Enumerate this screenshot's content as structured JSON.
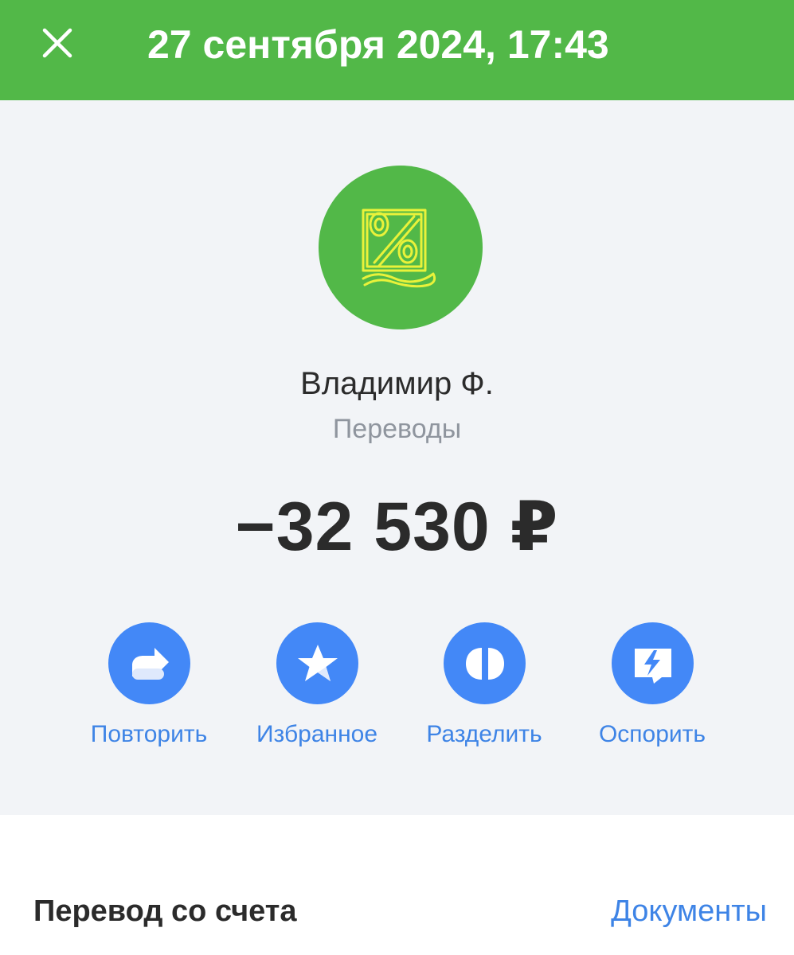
{
  "header": {
    "title": "27 сентября 2024, 17:43",
    "background_color": "#52b848",
    "close_icon": "close-icon"
  },
  "counterparty": {
    "name": "Владимир Ф.",
    "category": "Переводы",
    "avatar_icon": "percent-emblem-icon"
  },
  "transaction": {
    "amount": "−32 530 ₽"
  },
  "actions": [
    {
      "label": "Повторить",
      "icon": "repeat-arrow-icon"
    },
    {
      "label": "Избранное",
      "icon": "star-icon"
    },
    {
      "label": "Разделить",
      "icon": "split-icon"
    },
    {
      "label": "Оспорить",
      "icon": "dispute-icon"
    }
  ],
  "details": {
    "section_title": "Перевод со счета",
    "documents_link": "Документы"
  },
  "colors": {
    "accent_blue": "#4388f7",
    "link_blue": "#3e84e6",
    "text_dark": "#2b2b2b",
    "text_muted": "#8f959e",
    "panel_background": "#f2f4f7"
  }
}
